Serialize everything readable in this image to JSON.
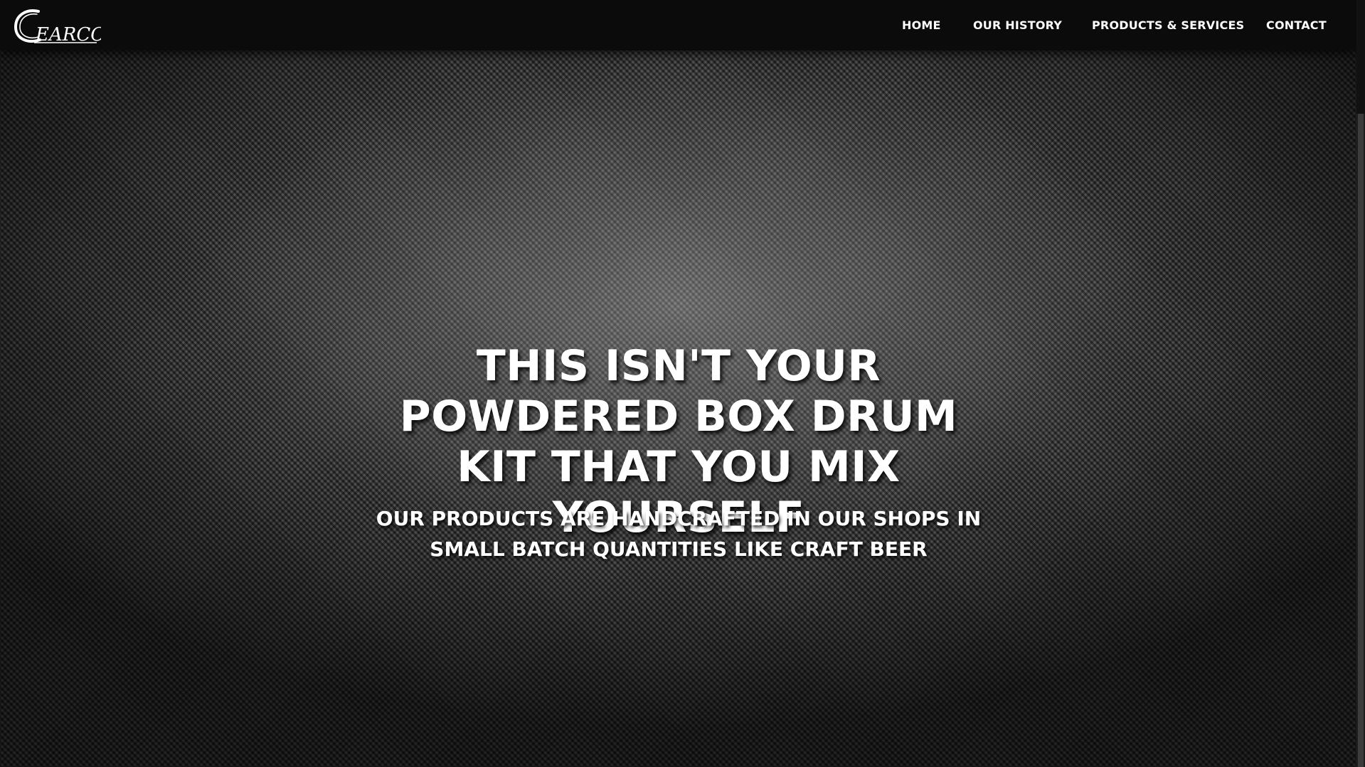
{
  "header": {
    "logo_text": "CEARCO",
    "nav": [
      {
        "label": "HOME"
      },
      {
        "label": "OUR HISTORY"
      },
      {
        "label": "PRODUCTS & SERVICES"
      },
      {
        "label": "CONTACT"
      }
    ]
  },
  "hero": {
    "headline": "THIS ISN'T YOUR POWDERED BOX DRUM KIT THAT YOU MIX YOURSELF",
    "subheadline": "OUR PRODUCTS ARE HANDCRAFTED IN OUR SHOPS IN SMALL BATCH QUANTITIES LIKE CRAFT BEER"
  },
  "colors": {
    "navbar_bg": "#0b0b0b",
    "text": "#ffffff",
    "hero_base": "#3a3a3a"
  }
}
